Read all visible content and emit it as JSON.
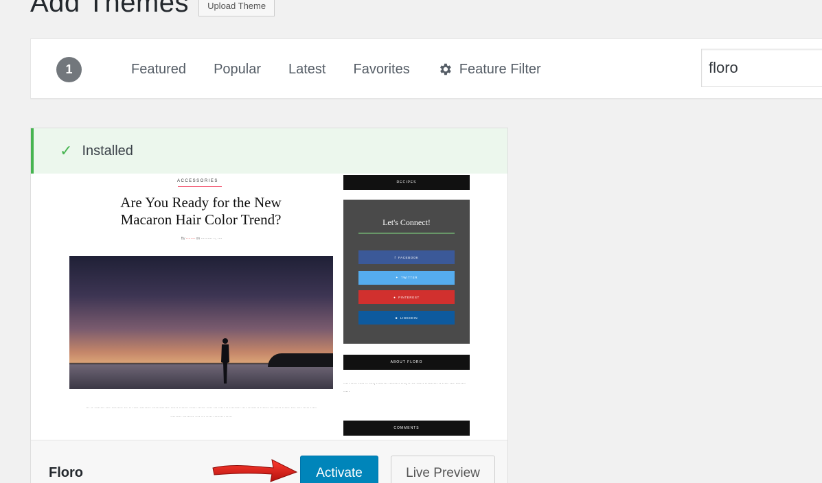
{
  "page": {
    "title": "Add Themes",
    "upload_label": "Upload Theme"
  },
  "filter_bar": {
    "count": "1",
    "links": [
      "Featured",
      "Popular",
      "Latest",
      "Favorites"
    ],
    "feature_filter_label": "Feature Filter",
    "search_value": "floro"
  },
  "theme": {
    "notice": "Installed",
    "name": "Floro",
    "activate_label": "Activate",
    "preview_label": "Live Preview",
    "screenshot": {
      "post_title": "Are You Ready for the New Macaron Hair Color Trend?",
      "connect_title": "Let's Connect!"
    }
  },
  "colors": {
    "accent": "#0085ba",
    "installed_green": "#46b450",
    "arrow_red": "#e0201b"
  }
}
